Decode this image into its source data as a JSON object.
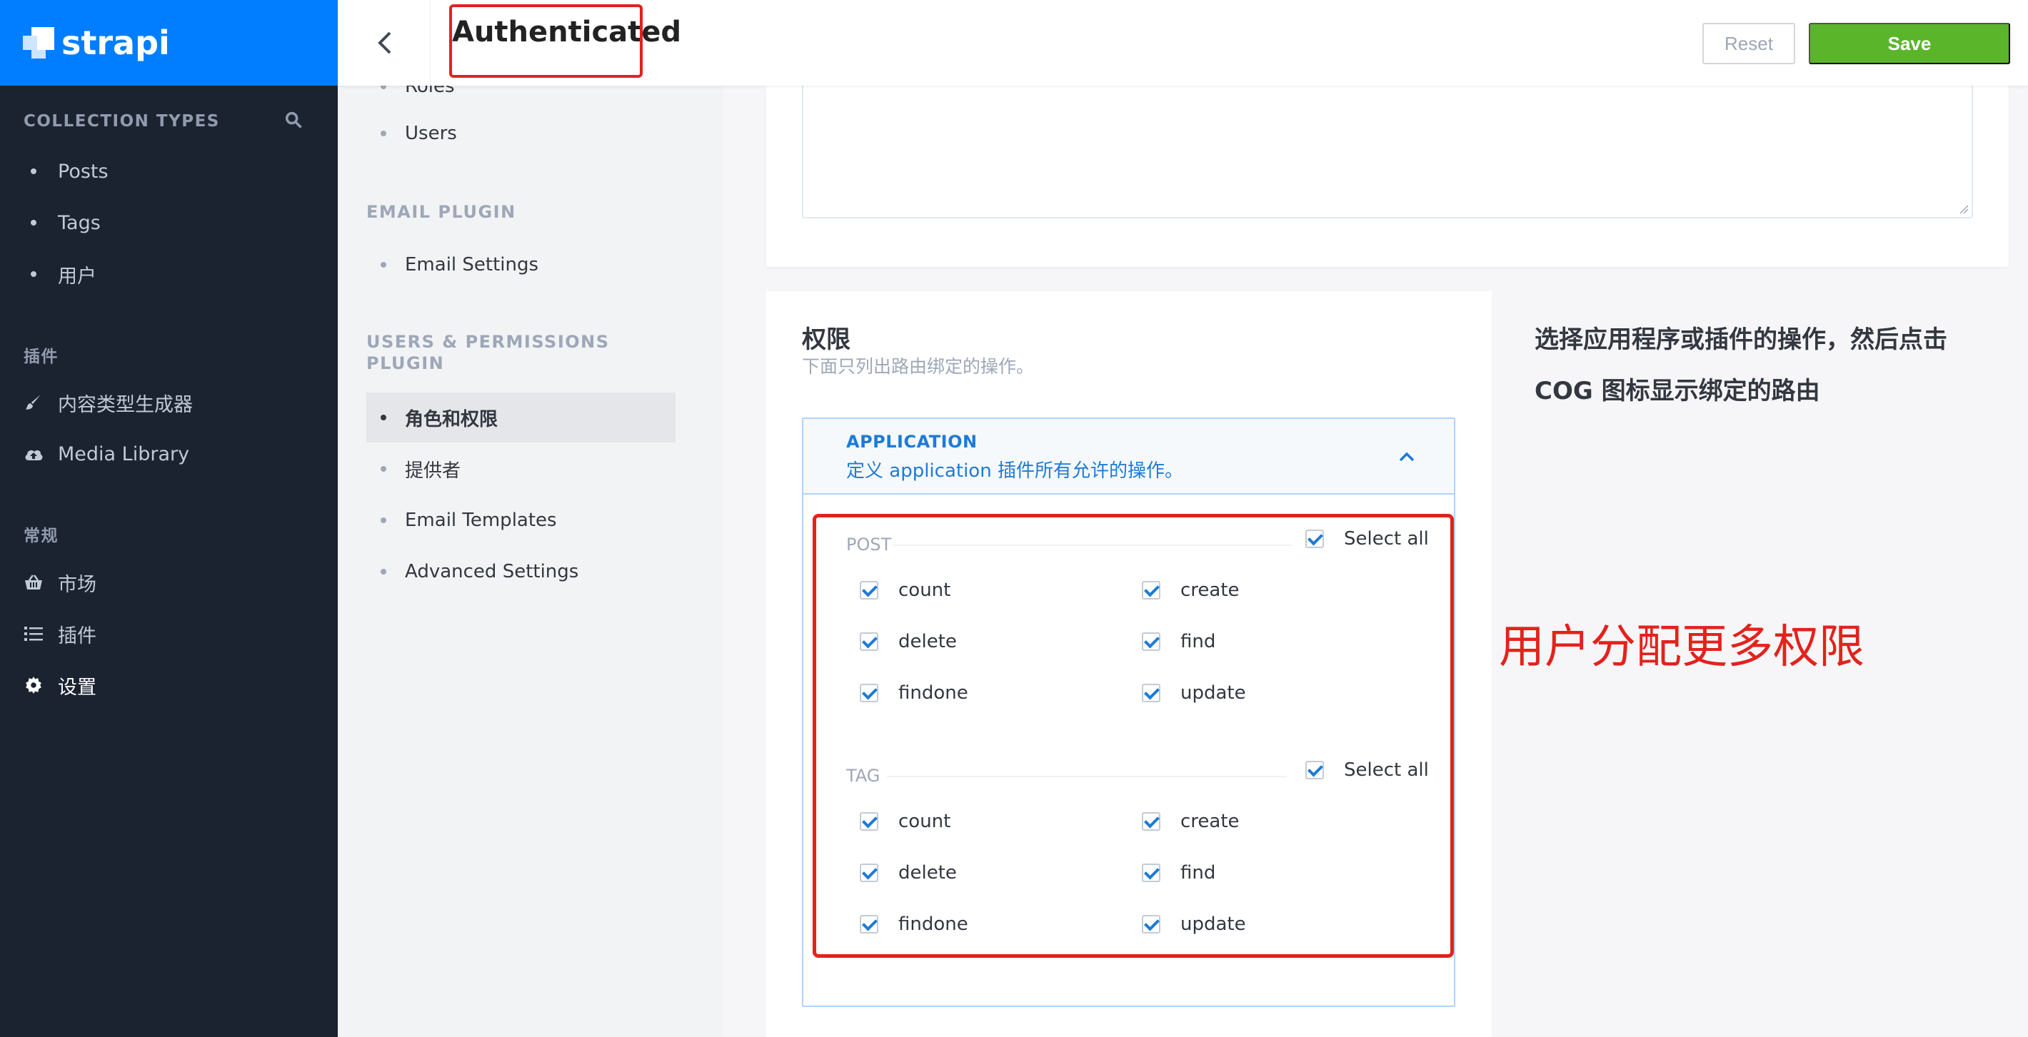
{
  "brand": {
    "name": "strapi"
  },
  "left_nav": {
    "collection_types_label": "COLLECTION TYPES",
    "collection_types": [
      "Posts",
      "Tags",
      "用户"
    ],
    "plugins_label": "插件",
    "plugins": [
      {
        "label": "内容类型生成器",
        "icon": "paintbrush-icon"
      },
      {
        "label": "Media Library",
        "icon": "cloud-upload-icon"
      }
    ],
    "general_label": "常规",
    "general": [
      {
        "label": "市场",
        "icon": "basket-icon"
      },
      {
        "label": "插件",
        "icon": "list-icon"
      },
      {
        "label": "设置",
        "icon": "gear-icon",
        "active": true
      }
    ]
  },
  "header": {
    "title": "Authenticated",
    "reset_label": "Reset",
    "save_label": "Save",
    "colors": {
      "save": "#5ab52a",
      "brand": "#007eff",
      "annotation": "#e3221b"
    }
  },
  "sub_nav": {
    "partial_item": "Roles",
    "users_item": "Users",
    "email_plugin_label": "EMAIL PLUGIN",
    "email_settings": "Email Settings",
    "up_plugin_label_1": "USERS & PERMISSIONS",
    "up_plugin_label_2": "PLUGIN",
    "up_items": [
      "角色和权限",
      "提供者",
      "Email Templates",
      "Advanced Settings"
    ]
  },
  "permissions": {
    "title": "权限",
    "subtitle": "下面只列出路由绑定的操作。",
    "help_text": "选择应用程序或插件的操作，然后点击 COG 图标显示绑定的路由",
    "application": {
      "title": "APPLICATION",
      "description": "定义 application 插件所有允许的操作。"
    },
    "groups": [
      {
        "name": "POST",
        "select_all": "Select all",
        "actions": [
          "count",
          "create",
          "delete",
          "find",
          "findone",
          "update"
        ]
      },
      {
        "name": "TAG",
        "select_all": "Select all",
        "actions": [
          "count",
          "create",
          "delete",
          "find",
          "findone",
          "update"
        ]
      }
    ]
  },
  "annotation_text": "用户分配更多权限"
}
